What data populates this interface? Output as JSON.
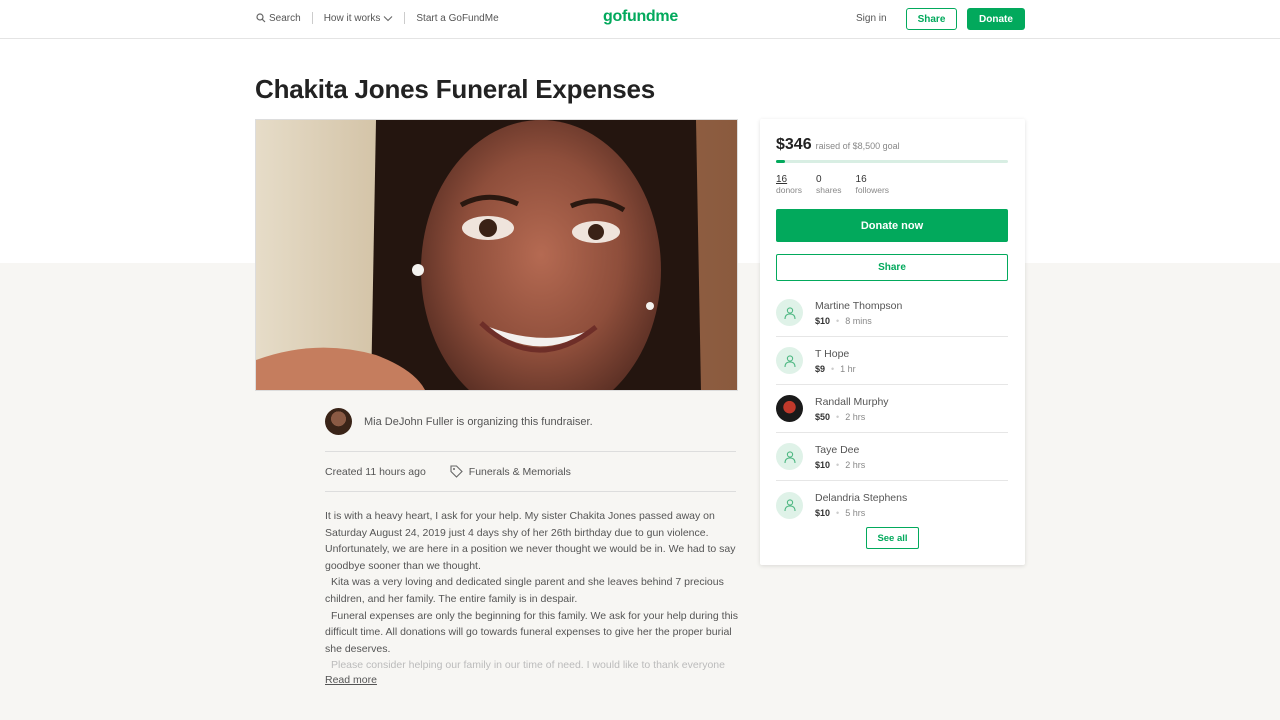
{
  "nav": {
    "search": "Search",
    "how_it_works": "How it works",
    "start": "Start a GoFundMe",
    "logo": "gofundme",
    "sign_in": "Sign in",
    "share": "Share",
    "donate": "Donate"
  },
  "campaign": {
    "title": "Chakita Jones Funeral Expenses",
    "organizer_text": "Mia DeJohn Fuller is organizing this fundraiser.",
    "created": "Created 11 hours ago",
    "category": "Funerals & Memorials",
    "story": [
      "It is with a heavy heart, I ask for your help. My sister Chakita Jones passed away on Saturday August 24, 2019 just 4 days shy of her 26th birthday due to gun violence. Unfortunately, we are here in a position we never thought we would be in. We had to say goodbye sooner than we thought.",
      "Kita was a very loving and dedicated single parent and she leaves behind 7 precious children, and her family. The entire family is in despair.",
      "Funeral expenses are only the beginning for this family. We ask for your help during this difficult time. All donations will go towards funeral expenses to give her the proper burial she deserves.",
      "Please consider helping our family in our time of need. I would like to thank everyone"
    ],
    "read_more": "Read more"
  },
  "card": {
    "raised": "$346",
    "goal_text": "raised of $8,500 goal",
    "progress_fraction": 0.04,
    "stats": [
      {
        "num": "16",
        "label": "donors"
      },
      {
        "num": "0",
        "label": "shares"
      },
      {
        "num": "16",
        "label": "followers"
      }
    ],
    "donate_now": "Donate now",
    "share": "Share",
    "donors": [
      {
        "name": "Martine Thompson",
        "amount": "$10",
        "time": "8 mins",
        "avatar": "person-icon"
      },
      {
        "name": "T Hope",
        "amount": "$9",
        "time": "1 hr",
        "avatar": "person-icon"
      },
      {
        "name": "Randall Murphy",
        "amount": "$50",
        "time": "2 hrs",
        "avatar": "photo"
      },
      {
        "name": "Taye Dee",
        "amount": "$10",
        "time": "2 hrs",
        "avatar": "person-icon"
      },
      {
        "name": "Delandria Stephens",
        "amount": "$10",
        "time": "5 hrs",
        "avatar": "person-icon"
      }
    ],
    "see_all": "See all"
  },
  "colors": {
    "brand_green": "#02a95c"
  }
}
